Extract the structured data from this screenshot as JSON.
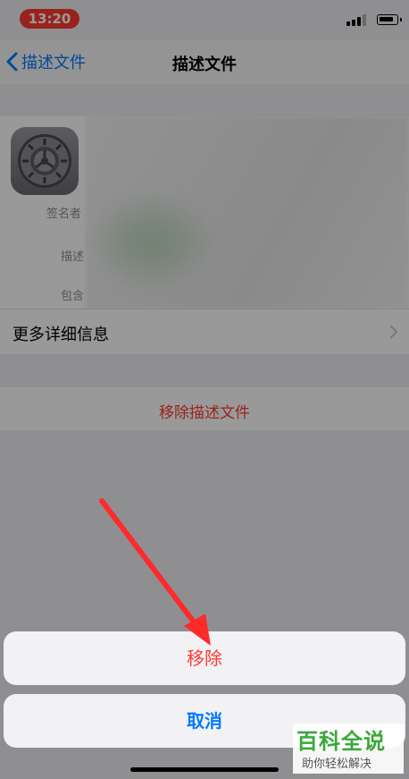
{
  "status_bar": {
    "time": "13:20",
    "time_pill_color": "#ff3b30"
  },
  "nav": {
    "back_label": "描述文件",
    "title": "描述文件"
  },
  "profile": {
    "icon": "settings-gear-icon",
    "fields": {
      "signed_label": "签名者",
      "description_label": "描述",
      "contains_label": "包含"
    }
  },
  "rows": {
    "more_details": "更多详细信息",
    "remove_profile": "移除描述文件"
  },
  "action_sheet": {
    "remove_label": "移除",
    "cancel_label": "取消"
  },
  "watermark": {
    "title": "百科全说",
    "subtitle": "助你轻松解决"
  },
  "colors": {
    "destructive": "#ff3b30",
    "accent": "#007aff",
    "watermark_green": "#3aa83a"
  }
}
